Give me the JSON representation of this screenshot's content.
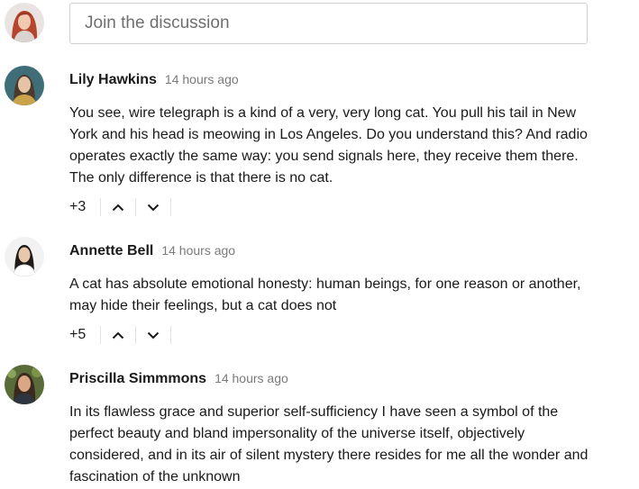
{
  "composer": {
    "placeholder": "Join the discussion"
  },
  "comments": [
    {
      "author": "Lily Hawkins",
      "time": "14 hours ago",
      "text": "You see, wire telegraph is a kind of a very, very long cat. You pull his tail in New York and his head is meowing in Los Angeles. Do you understand this? And radio operates exactly the same way: you send signals here, they receive them there. The only difference is that there is no cat.",
      "votes": "+3"
    },
    {
      "author": "Annette Bell",
      "time": "14 hours ago",
      "text": "A cat has absolute emotional honesty: human beings, for one reason or another, may hide their feelings, but a cat does not",
      "votes": "+5"
    },
    {
      "author": "Priscilla Simmmons",
      "time": "14 hours ago",
      "text": "In its flawless grace and superior self-sufficiency I have seen a symbol of the perfect beauty and bland impersonality of the universe itself, objectively considered, and in its air of silent mystery there resides for me all the wonder and fascination of the unknown"
    }
  ],
  "icons": {
    "upvote": "chevron-up-icon",
    "downvote": "chevron-down-icon"
  },
  "colors": {
    "text": "#1a1a1a",
    "muted": "#7a7a7a",
    "border": "#cfcfcf",
    "divider": "#e2e2e2"
  }
}
